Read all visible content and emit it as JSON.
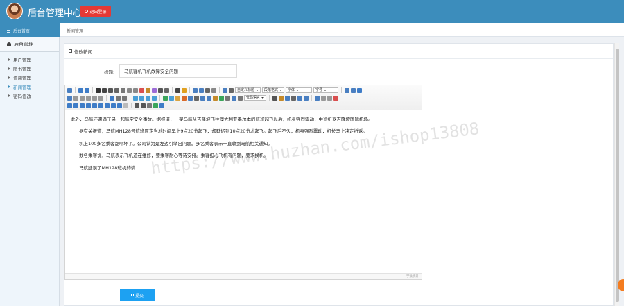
{
  "header": {
    "brand": "后台管理中心",
    "logout_label": "退出登录"
  },
  "subbar": {
    "side_label": "后台首页",
    "breadcrumb": "新闻管理"
  },
  "sidebar": {
    "title": "后台管理",
    "items": [
      {
        "label": "用户管理"
      },
      {
        "label": "图书管理"
      },
      {
        "label": "借阅管理"
      },
      {
        "label": "新闻管理",
        "active": true
      },
      {
        "label": "密码修改"
      }
    ]
  },
  "panel": {
    "heading": "修改新闻"
  },
  "form": {
    "title_label": "标题:",
    "title_value": "马航客机飞机故障安全问题"
  },
  "editor": {
    "selects": [
      "自定义标题",
      "段落格式",
      "字体",
      "字号"
    ],
    "paragraphs": [
      {
        "text": "此外，马航还遭遇了另一起航空安全事故。据报道，一架马航从吉隆坡飞往澳大利亚墨尔本的航班起飞以后，机身强烈震动，中途折返吉隆坡国际机场。",
        "indent": false
      },
      {
        "text": "据有关报道，马航MH128号航班原定当地时间早上9点20分起飞，却延迟到10点20分才起飞。起飞后不久，机身强烈震动，机长马上决定折返。",
        "indent": true
      },
      {
        "text": "机上100多名乘客都吓坏了。公司认为是左边引擎出问题。多名乘客表示一直收到马航相关通知。",
        "indent": true
      },
      {
        "text": "数名乘客说，马航表示飞机还在维修，要乘客耐心等待安排。乘客担心飞机有问题，要求换机。",
        "indent": true
      },
      {
        "text": "马航延误了MH128班机的情",
        "indent": true
      }
    ],
    "word_count": "字数统计"
  },
  "submit_label": "提交",
  "watermark": "https://www.huzhan.com/ishop13808",
  "colors": {
    "header": "#3c8dbc",
    "logout": "#e53935",
    "submit": "#1da1f2",
    "active_nav": "#3c8dbc"
  }
}
